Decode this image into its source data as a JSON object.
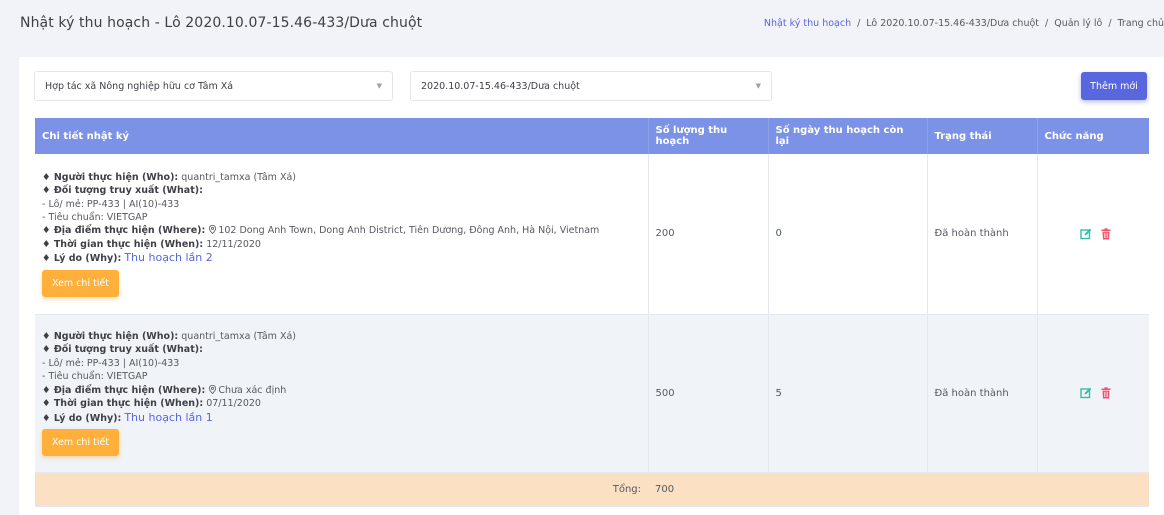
{
  "header": {
    "title": "Nhật ký thu hoạch - Lô 2020.10.07-15.46-433/Dưa chuột",
    "breadcrumb": [
      "Nhật ký thu hoạch",
      "Lô 2020.10.07-15.46-433/Dưa chuột",
      "Quản lý lô",
      "Trang chủ"
    ]
  },
  "filters": {
    "cooperative": "Hợp tác xã Nông nghiệp hữu cơ Tâm Xá",
    "lot": "2020.10.07-15.46-433/Dưa chuột"
  },
  "add_button": "Thêm mới",
  "table": {
    "columns": [
      "Chi tiết nhật ký",
      "Số lượng thu hoạch",
      "Số ngày thu hoạch còn lại",
      "Trạng thái",
      "Chức năng"
    ],
    "rows": [
      {
        "who_label": "♦ Người thực hiện (Who):",
        "who": "quantri_tamxa (Tâm Xá)",
        "what_label": "♦ Đối tượng truy xuất (What):",
        "lot_line": "- Lô/ mẻ: PP-433 | AI(10)-433",
        "standard_line": "- Tiêu chuẩn: VIETGAP",
        "where_label": "♦ Địa điểm thực hiện (Where):",
        "where": "102 Dong Anh Town, Dong Anh District, Tiên Dương, Đông Anh, Hà Nội, Vietnam",
        "when_label": "♦ Thời gian thực hiện (When):",
        "when": "12/11/2020",
        "why_label": "♦ Lý do (Why):",
        "why": "Thu hoạch lần 2",
        "view_button": "Xem chi tiết",
        "quantity": "200",
        "days_left": "0",
        "status": "Đã hoàn thành"
      },
      {
        "who_label": "♦ Người thực hiện (Who):",
        "who": "quantri_tamxa (Tâm Xá)",
        "what_label": "♦ Đối tượng truy xuất (What):",
        "lot_line": "- Lô/ mẻ: PP-433 | AI(10)-433",
        "standard_line": "- Tiêu chuẩn: VIETGAP",
        "where_label": "♦ Địa điểm thực hiện (Where):",
        "where": "Chưa xác định",
        "when_label": "♦ Thời gian thực hiện (When):",
        "when": "07/11/2020",
        "why_label": "♦ Lý do (Why):",
        "why": "Thu hoạch lần 1",
        "view_button": "Xem chi tiết",
        "quantity": "500",
        "days_left": "5",
        "status": "Đã hoàn thành"
      }
    ],
    "total_label": "Tổng:",
    "total_value": "700"
  },
  "icons": {
    "edit": "edit-icon",
    "delete": "trash-icon",
    "location": "location-pin-icon",
    "dropdown": "chevron-down-icon"
  },
  "colors": {
    "header_bg": "#7b92e6",
    "primary": "#5867dd",
    "warning": "#ffb03a",
    "total_bg": "#fbe0c3",
    "edit_icon": "#34bfa3",
    "delete_icon": "#f4516c"
  }
}
